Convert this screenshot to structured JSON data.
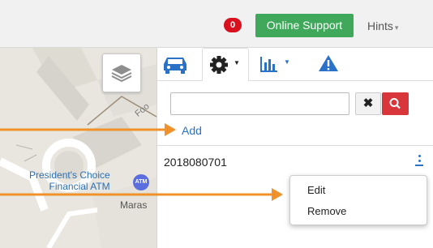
{
  "topbar": {
    "notification_count": "0",
    "support_label": "Online Support",
    "hints_label": "Hints",
    "hints_caret": "▾"
  },
  "map": {
    "street_label": "Foo",
    "poi_label_line1": "President's Choice",
    "poi_label_line2": "Financial ATM",
    "atm_marker": "ATM",
    "street_label_2": "Maras",
    "layers_icon": "layers-icon"
  },
  "panel": {
    "tabs": [
      {
        "icon": "car-icon"
      },
      {
        "icon": "gear-icon",
        "active": true
      },
      {
        "icon": "bar-chart-icon"
      },
      {
        "icon": "warning-icon"
      }
    ],
    "search": {
      "value": "",
      "placeholder": ""
    },
    "clear_glyph": "✖",
    "add_label": "Add",
    "rows": [
      {
        "id": "2018080701"
      }
    ],
    "menu": {
      "edit_label": "Edit",
      "remove_label": "Remove"
    }
  },
  "colors": {
    "badge": "#d9101e",
    "support": "#3fa85a",
    "link": "#2a72c8",
    "search_button": "#d8363a",
    "arrow": "#f0922b"
  }
}
